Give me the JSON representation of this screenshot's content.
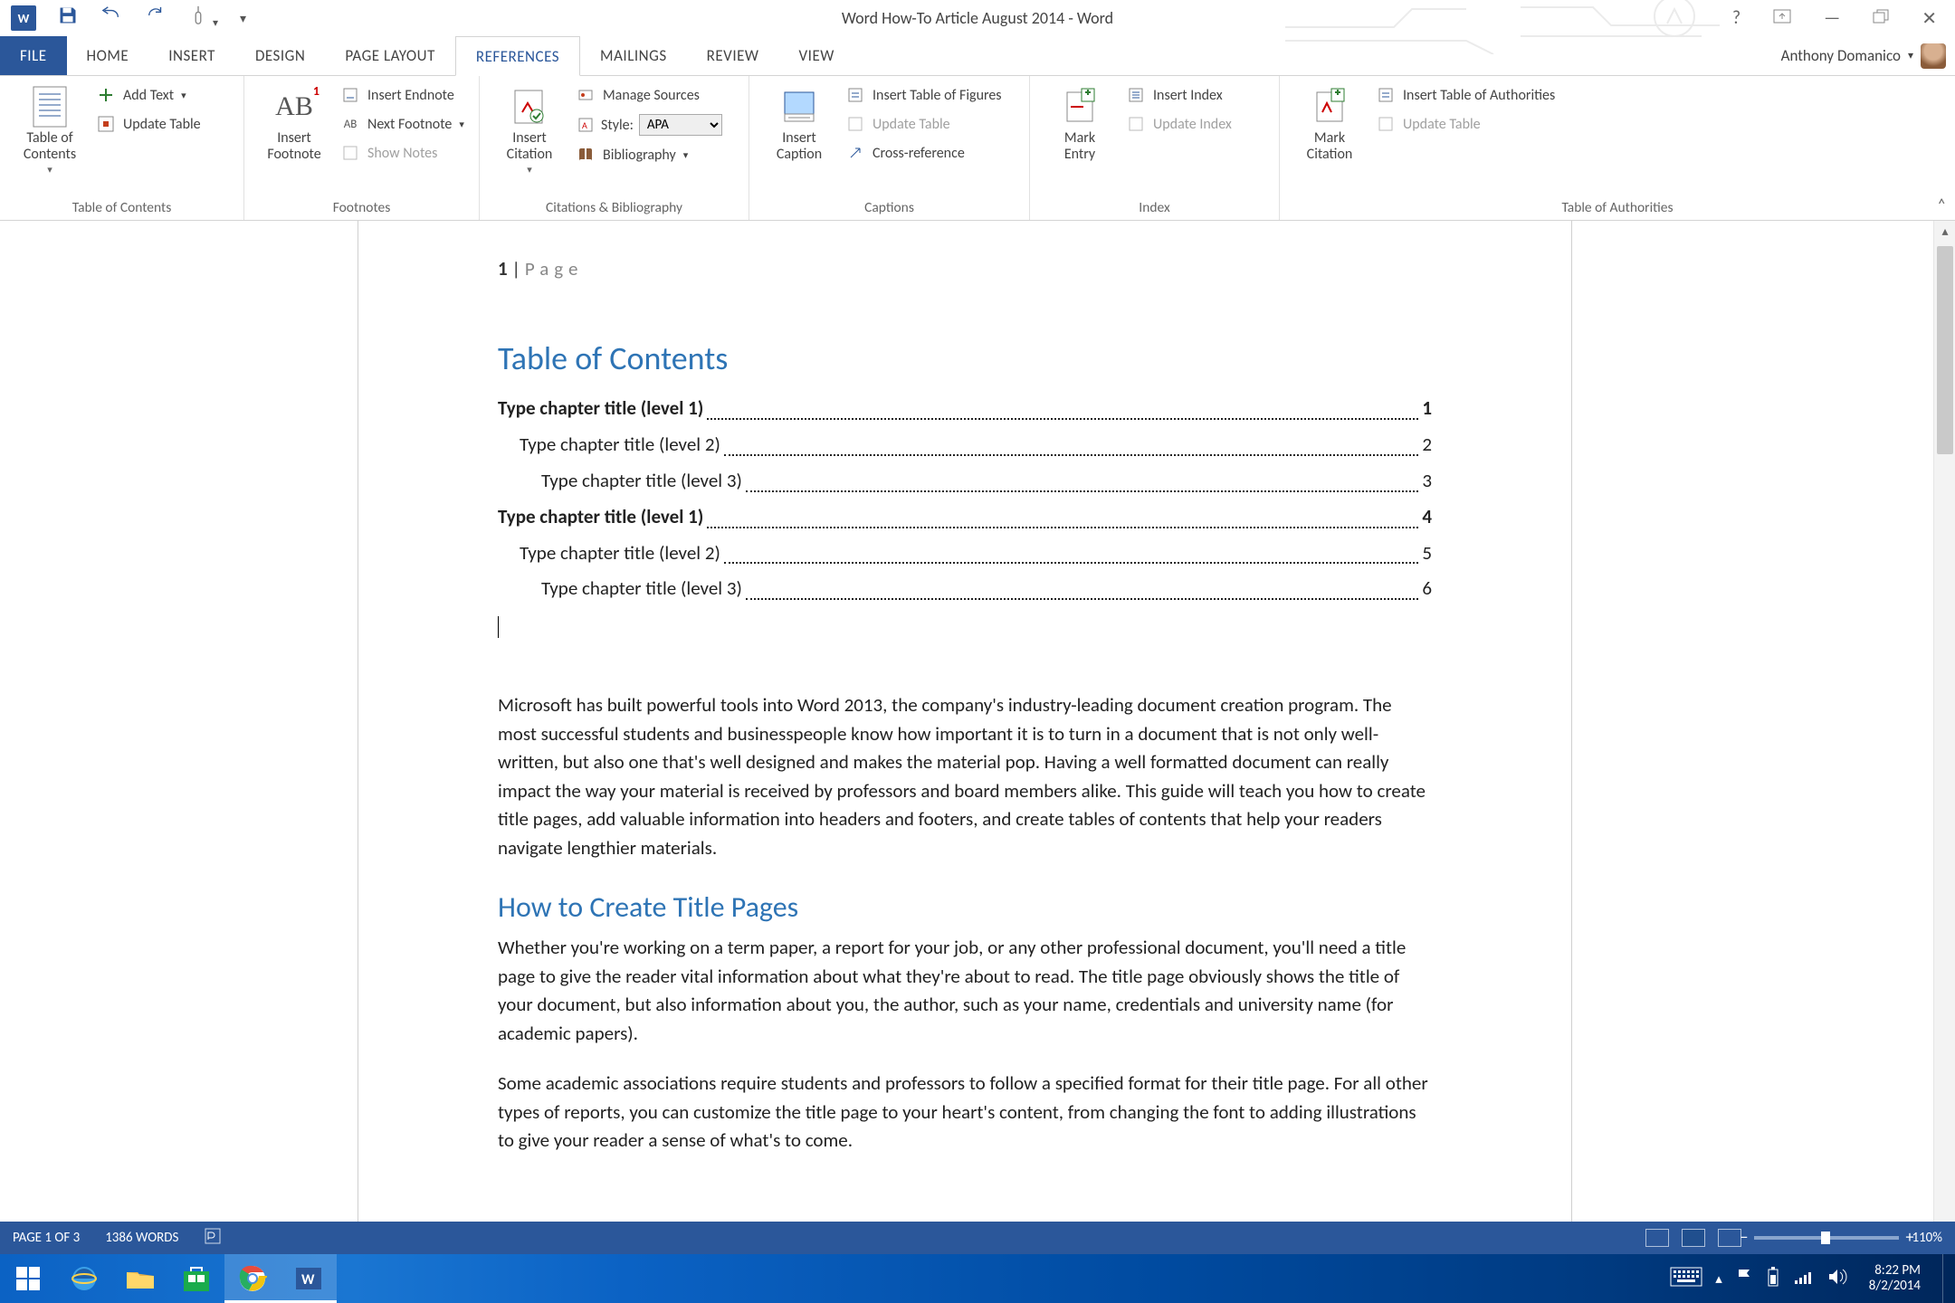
{
  "titlebar": {
    "doc_title": "Word How-To Article August 2014 - Word"
  },
  "tabs": {
    "file": "FILE",
    "list": [
      "HOME",
      "INSERT",
      "DESIGN",
      "PAGE LAYOUT",
      "REFERENCES",
      "MAILINGS",
      "REVIEW",
      "VIEW"
    ],
    "active": "REFERENCES",
    "user": "Anthony Domanico"
  },
  "ribbon": {
    "groups": {
      "toc": {
        "big": "Table of\nContents",
        "add_text": "Add Text",
        "update": "Update Table",
        "label": "Table of Contents"
      },
      "footnotes": {
        "big": "Insert\nFootnote",
        "endnote": "Insert Endnote",
        "next": "Next Footnote",
        "show": "Show Notes",
        "label": "Footnotes"
      },
      "citations": {
        "big": "Insert\nCitation",
        "manage": "Manage Sources",
        "style_label": "Style:",
        "style_value": "APA",
        "biblio": "Bibliography",
        "label": "Citations & Bibliography"
      },
      "captions": {
        "big": "Insert\nCaption",
        "figs": "Insert Table of Figures",
        "update": "Update Table",
        "cross": "Cross-reference",
        "label": "Captions"
      },
      "index": {
        "big": "Mark\nEntry",
        "insert": "Insert Index",
        "update": "Update Index",
        "label": "Index"
      },
      "toa": {
        "big": "Mark\nCitation",
        "insert": "Insert Table of Authorities",
        "update": "Update Table",
        "label": "Table of Authorities"
      }
    }
  },
  "document": {
    "header_num": "1",
    "header_sep": " | ",
    "header_page": "Page",
    "toc_title": "Table of Contents",
    "toc": [
      {
        "level": 1,
        "title": "Type chapter title (level 1)",
        "page": "1"
      },
      {
        "level": 2,
        "title": "Type chapter title (level 2)",
        "page": "2"
      },
      {
        "level": 3,
        "title": "Type chapter title (level 3)",
        "page": "3"
      },
      {
        "level": 1,
        "title": "Type chapter title (level 1)",
        "page": "4"
      },
      {
        "level": 2,
        "title": "Type chapter title (level 2)",
        "page": "5"
      },
      {
        "level": 3,
        "title": "Type chapter title (level 3)",
        "page": "6"
      }
    ],
    "para1": "Microsoft has built powerful tools into Word 2013, the company's industry-leading document creation program. The most successful students and businesspeople know how important it is to turn in a document that is not only well-written, but also one that's well designed and makes the material pop. Having a well formatted document can really impact the way your material is received by professors and board members alike. This guide will teach you how to create title pages, add valuable information into headers and footers, and create tables of contents that help your readers navigate lengthier materials.",
    "h2": "How to Create Title Pages",
    "para2": "Whether you're working on a term paper, a report for your job, or any other professional document, you'll need a title page to give the reader vital information about what they're about to read. The title page obviously shows the title of your document, but also information about you, the author, such as your name, credentials and university name (for academic papers).",
    "para3": "Some academic associations require students and professors to follow a specified format for their title page. For all other types of reports, you can customize the title page to your heart's content, from changing the font to adding illustrations to give your reader a sense of what's to come."
  },
  "status": {
    "page": "PAGE 1 OF 3",
    "words": "1386 WORDS",
    "zoom": "110%"
  },
  "taskbar": {
    "time": "8:22 PM",
    "date": "8/2/2014"
  }
}
